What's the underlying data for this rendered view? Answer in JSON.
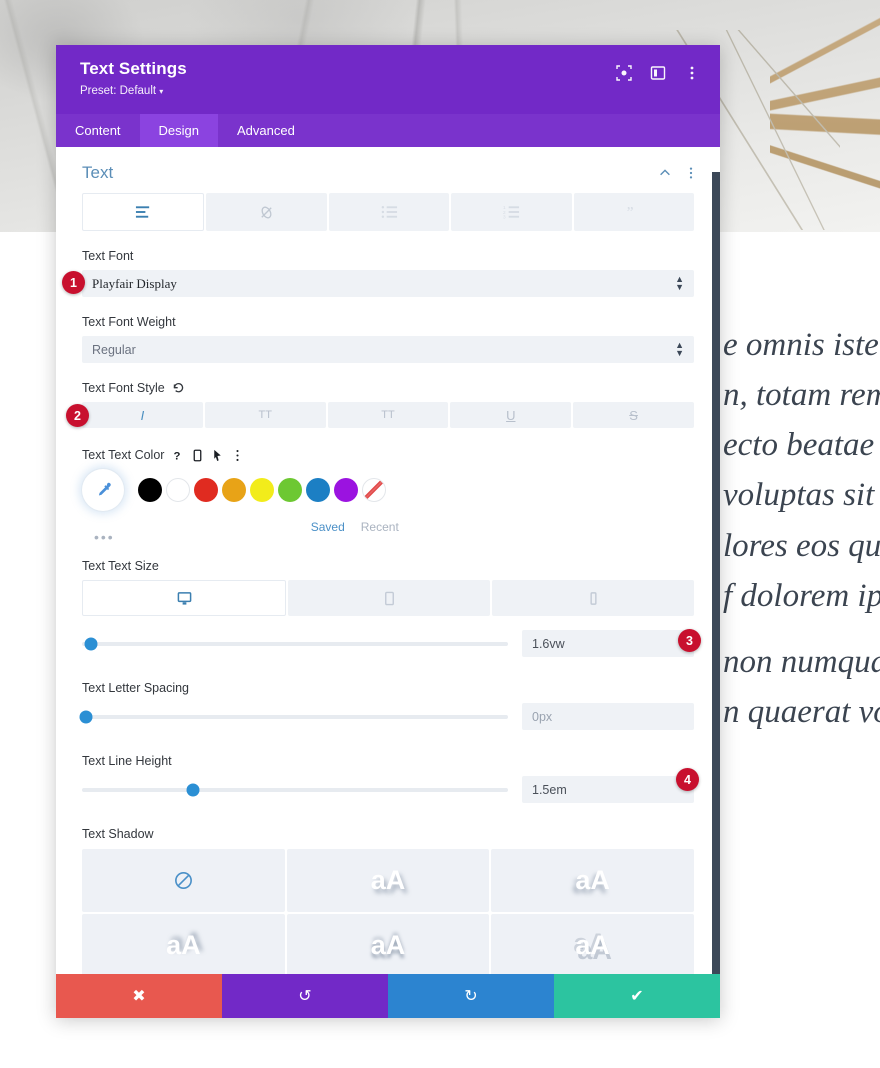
{
  "background": {
    "photo_description": "winter snow scene with dry plant stems",
    "page_text_paragraph_1": "e omnis iste\nn, totam rem\necto beatae\nvoluptas sit\nlores eos qu\nf dolorem ip",
    "page_text_paragraph_2": "non numqua\nn quaerat vo"
  },
  "modal": {
    "title": "Text Settings",
    "preset_label": "Preset: Default",
    "preset_caret": "▾",
    "header_icons": [
      {
        "name": "focus-target-icon"
      },
      {
        "name": "layout-panel-icon"
      },
      {
        "name": "more-vertical-icon"
      }
    ],
    "tabs": [
      {
        "label": "Content",
        "active": false
      },
      {
        "label": "Design",
        "active": true
      },
      {
        "label": "Advanced",
        "active": false
      }
    ],
    "section": {
      "title": "Text",
      "collapse_icon": "chevron-up-icon",
      "menu_icon": "more-vertical-icon"
    },
    "toolbar": [
      {
        "name": "text-align-icon",
        "active": true
      },
      {
        "name": "link-icon",
        "active": false
      },
      {
        "name": "bulleted-list-icon",
        "active": false
      },
      {
        "name": "numbered-list-icon",
        "active": false
      },
      {
        "name": "blockquote-icon",
        "active": false
      }
    ],
    "fields": {
      "text_font": {
        "label": "Text Font",
        "value": "Playfair Display",
        "badge": "1"
      },
      "text_font_weight": {
        "label": "Text Font Weight",
        "value": "Regular"
      },
      "text_font_style": {
        "label": "Text Font Style",
        "reset_icon": "undo-reset-icon",
        "badge": "2",
        "options": [
          {
            "glyph": "I",
            "name": "italic-button",
            "active": true
          },
          {
            "glyph": "TT",
            "name": "uppercase-button",
            "active": false
          },
          {
            "glyph": "TT",
            "name": "small-caps-button",
            "active": false
          },
          {
            "glyph": "U",
            "name": "underline-button",
            "active": false
          },
          {
            "glyph": "S",
            "name": "strikethrough-button",
            "active": false
          }
        ]
      },
      "text_text_color": {
        "label": "Text Text Color",
        "label_icons": [
          "help-icon",
          "mobile-icon",
          "cursor-icon",
          "more-vertical-icon"
        ],
        "eyedropper": "eyedropper-icon",
        "more_dots": "•••",
        "swatches": [
          {
            "name": "swatch-black",
            "hex": "#000000"
          },
          {
            "name": "swatch-white",
            "hex": "#ffffff"
          },
          {
            "name": "swatch-red",
            "hex": "#e02b20"
          },
          {
            "name": "swatch-orange",
            "hex": "#e8a317"
          },
          {
            "name": "swatch-yellow",
            "hex": "#f2ec1b"
          },
          {
            "name": "swatch-green",
            "hex": "#6dc832"
          },
          {
            "name": "swatch-blue",
            "hex": "#1c7fc4"
          },
          {
            "name": "swatch-purple",
            "hex": "#9b13e0"
          },
          {
            "name": "swatch-none",
            "hex": "transparent"
          }
        ],
        "saved_label": "Saved",
        "recent_label": "Recent"
      },
      "text_text_size": {
        "label": "Text Text Size",
        "devices": [
          {
            "name": "desktop-icon",
            "active": true
          },
          {
            "name": "tablet-icon",
            "active": false
          },
          {
            "name": "phone-icon",
            "active": false
          }
        ],
        "value": "1.6vw",
        "slider_percent": 2,
        "badge": "3"
      },
      "text_letter_spacing": {
        "label": "Text Letter Spacing",
        "value": "0px",
        "slider_percent": 1
      },
      "text_line_height": {
        "label": "Text Line Height",
        "value": "1.5em",
        "slider_percent": 26,
        "badge": "4"
      },
      "text_shadow": {
        "label": "Text Shadow",
        "options": [
          {
            "name": "shadow-none",
            "glyph": "",
            "icon": "no-shadow-icon",
            "active": true
          },
          {
            "name": "shadow-style-1",
            "glyph": "aA"
          },
          {
            "name": "shadow-style-2",
            "glyph": "aA"
          },
          {
            "name": "shadow-style-3",
            "glyph": "aA"
          },
          {
            "name": "shadow-style-4",
            "glyph": "aA"
          },
          {
            "name": "shadow-style-5",
            "glyph": "aA"
          }
        ]
      }
    },
    "footer": [
      {
        "name": "cancel-button",
        "glyph": "✖",
        "color": "#e8584f"
      },
      {
        "name": "undo-button",
        "glyph": "↺",
        "color": "#7229c7"
      },
      {
        "name": "redo-button",
        "glyph": "↻",
        "color": "#2c84d0"
      },
      {
        "name": "save-button",
        "glyph": "✔",
        "color": "#2cc4a0"
      }
    ]
  },
  "annotations": {
    "badge_1": "1",
    "badge_2": "2",
    "badge_3": "3",
    "badge_4": "4"
  }
}
